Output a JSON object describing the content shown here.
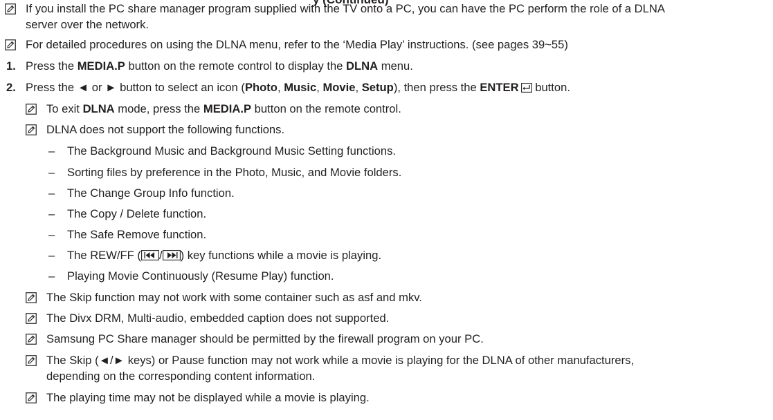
{
  "section_title_partial": "y (Continued)",
  "intro_notes": [
    {
      "line1": "If you install the PC share manager program supplied with the TV onto a PC, you can have the PC perform the role of a DLNA",
      "line2": "server over the network."
    },
    {
      "line1": "For detailed procedures on using the DLNA menu, refer to the ‘Media Play’ instructions. (see pages 39~55)"
    }
  ],
  "steps": [
    {
      "number": "1.",
      "t1": "Press the ",
      "b1": "MEDIA.P",
      "t2": " button on the remote control to display the ",
      "b2": "DLNA",
      "t3": " menu."
    },
    {
      "number": "2.",
      "t1": "Press the ◄ or ► button to select an icon (",
      "b1": "Photo",
      "s1": ", ",
      "b2": "Music",
      "s2": ", ",
      "b3": "Movie",
      "s3": ", ",
      "b4": "Setup",
      "t2": "), then press the ",
      "b5": "ENTER",
      "t3": " button."
    }
  ],
  "sub_notes": {
    "exit": {
      "t1": "To exit ",
      "b1": "DLNA",
      "t2": " mode, press the ",
      "b2": "MEDIA.P",
      "t3": " button on the remote control."
    },
    "unsupported_intro": "DLNA does not support the following functions.",
    "unsupported_items": [
      "The Background Music and Background Music Setting functions.",
      "Sorting files by preference in the Photo, Music, and Movie folders.",
      "The Change Group Info function.",
      "The Copy / Delete function.",
      "The Safe Remove function."
    ],
    "rewff_item": {
      "t1": "The REW/FF (",
      "t2": "/",
      "t3": ") key functions while a movie is playing."
    },
    "resume_item": "Playing Movie Continuously (Resume Play) function.",
    "more_notes": [
      "The Skip function may not work with some container such as asf and mkv.",
      "The Divx DRM, Multi-audio, embedded caption does not supported.",
      "Samsung PC Share manager should be permitted by the firewall program on your PC."
    ],
    "skip_note": {
      "line1": "The Skip (◄/► keys) or Pause function may not work while a movie is playing for the DLNA of other manufacturers,",
      "line2": "depending on the corresponding content information."
    },
    "last_note": "The playing time may not be displayed while a movie is playing."
  },
  "dash_symbol": "–",
  "icon_names": {
    "note": "note-pencil-icon",
    "enter": "enter-key-icon",
    "rewind": "rewind-key-icon",
    "fast_forward": "fast-forward-key-icon"
  },
  "colors": {
    "text": "#231f20"
  }
}
